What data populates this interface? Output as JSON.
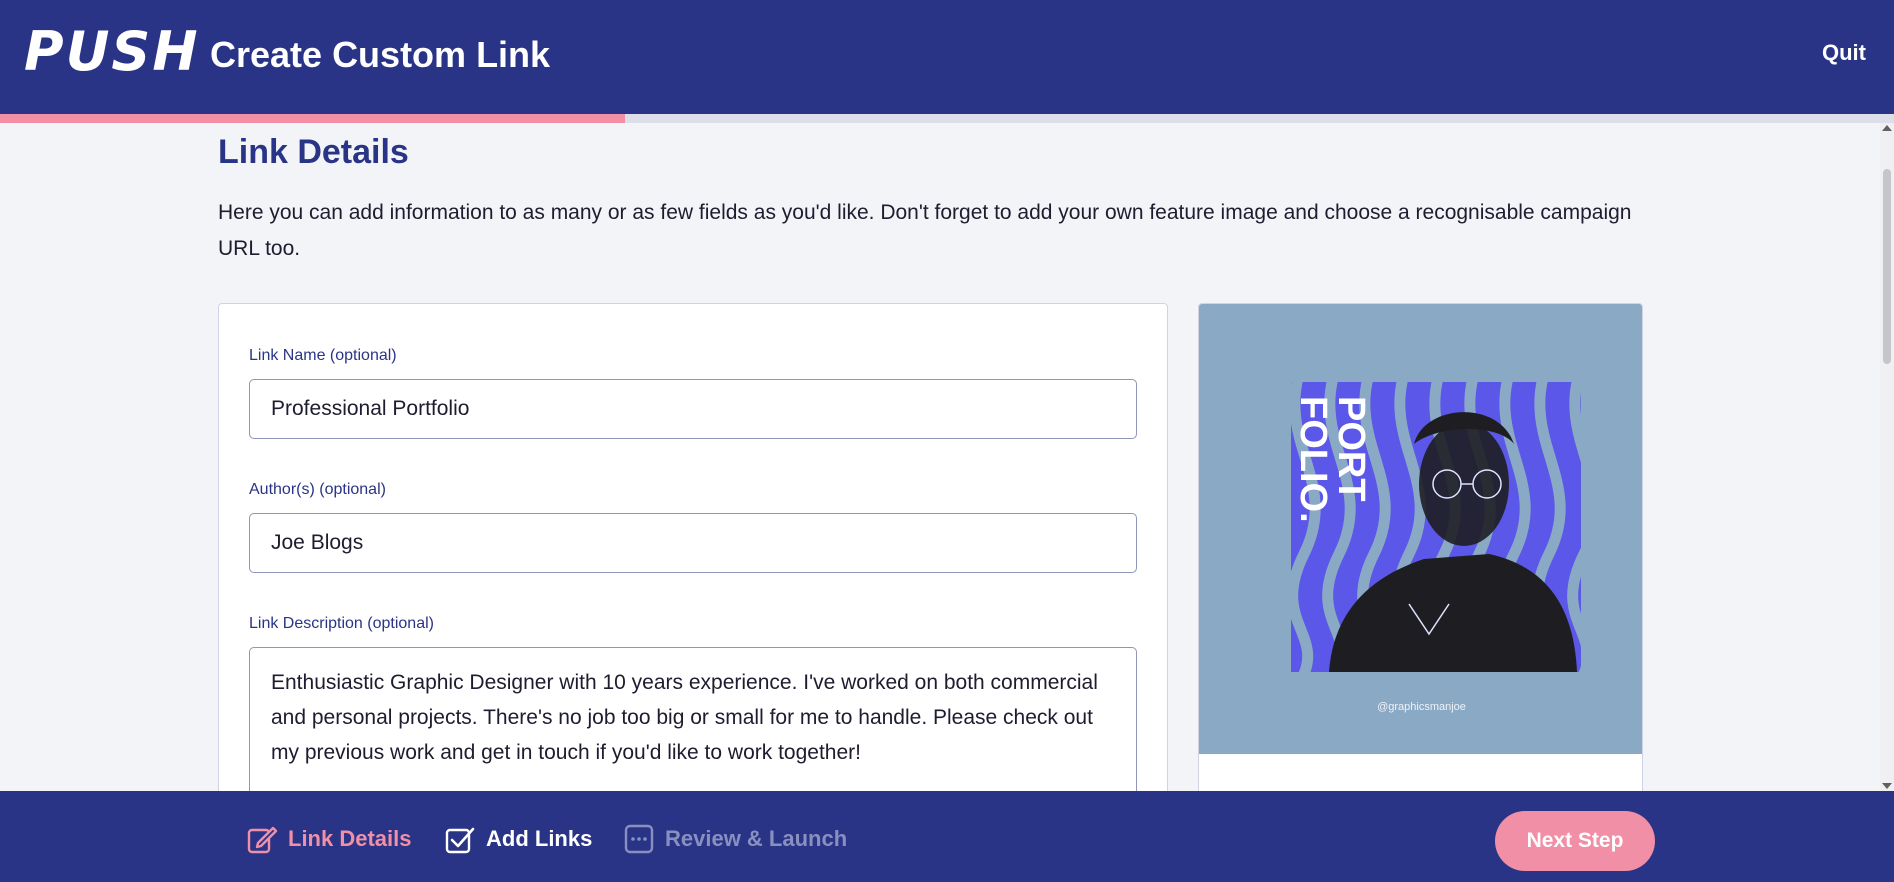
{
  "header": {
    "logo": "PUSH",
    "title": "Create Custom Link",
    "quit_label": "Quit"
  },
  "progress": {
    "fraction": 0.33
  },
  "section": {
    "title": "Link Details",
    "description": "Here you can add information to as many or as few fields as you'd like. Don't forget to add your own feature image and choose a recognisable campaign URL too."
  },
  "form": {
    "link_name": {
      "label": "Link Name (optional)",
      "value": "Professional Portfolio"
    },
    "authors": {
      "label": "Author(s) (optional)",
      "value": "Joe Blogs"
    },
    "link_description": {
      "label": "Link Description (optional)",
      "value": "Enthusiastic Graphic Designer with 10 years experience. I've worked on both commercial and personal projects. There's no job too big or small for me to handle. Please check out my previous work and get in touch if you'd like to work together!"
    }
  },
  "feature_image": {
    "title_line1": "PORT",
    "title_line2": "FOLIO.",
    "handle": "@graphicsmanjoe",
    "background_color": "#8aa9c5",
    "accent_color": "#5b57e8"
  },
  "footer": {
    "steps": [
      {
        "label": "Link Details",
        "icon": "edit-icon",
        "state": "active"
      },
      {
        "label": "Add Links",
        "icon": "checkbox-checked-icon",
        "state": "completed"
      },
      {
        "label": "Review & Launch",
        "icon": "dots-box-icon",
        "state": "upcoming"
      }
    ],
    "next_label": "Next Step"
  },
  "colors": {
    "primary": "#2a3486",
    "accent_pink": "#f08fa6",
    "muted_step": "#8890c0"
  }
}
